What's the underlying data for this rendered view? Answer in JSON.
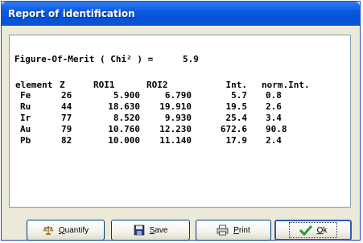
{
  "window": {
    "title": "Report of identification"
  },
  "report": {
    "fom_label": "Figure-Of-Merit ( Chi² ) =",
    "fom_value": "5.9",
    "columns": [
      "element",
      "Z",
      "ROI1",
      "ROI2",
      "Int.",
      "norm.Int."
    ],
    "rows": [
      [
        "Fe",
        "26",
        "5.900",
        "6.790",
        "5.7",
        "0.8"
      ],
      [
        "Ru",
        "44",
        "18.630",
        "19.910",
        "19.5",
        "2.6"
      ],
      [
        "Ir",
        "77",
        "8.520",
        "9.930",
        "25.4",
        "3.4"
      ],
      [
        "Au",
        "79",
        "10.760",
        "12.230",
        "672.6",
        "90.8"
      ],
      [
        "Pb",
        "82",
        "10.000",
        "11.140",
        "17.9",
        "2.4"
      ]
    ]
  },
  "buttons": {
    "quantify": {
      "first": "Q",
      "rest": "uantify",
      "icon": "scale-icon"
    },
    "save": {
      "first": "S",
      "rest": "ave",
      "icon": "floppy-disk-icon"
    },
    "print": {
      "first": "P",
      "rest": "rint",
      "icon": "printer-icon"
    },
    "ok": {
      "first": "O",
      "rest": "k",
      "icon": "checkmark-icon"
    }
  }
}
